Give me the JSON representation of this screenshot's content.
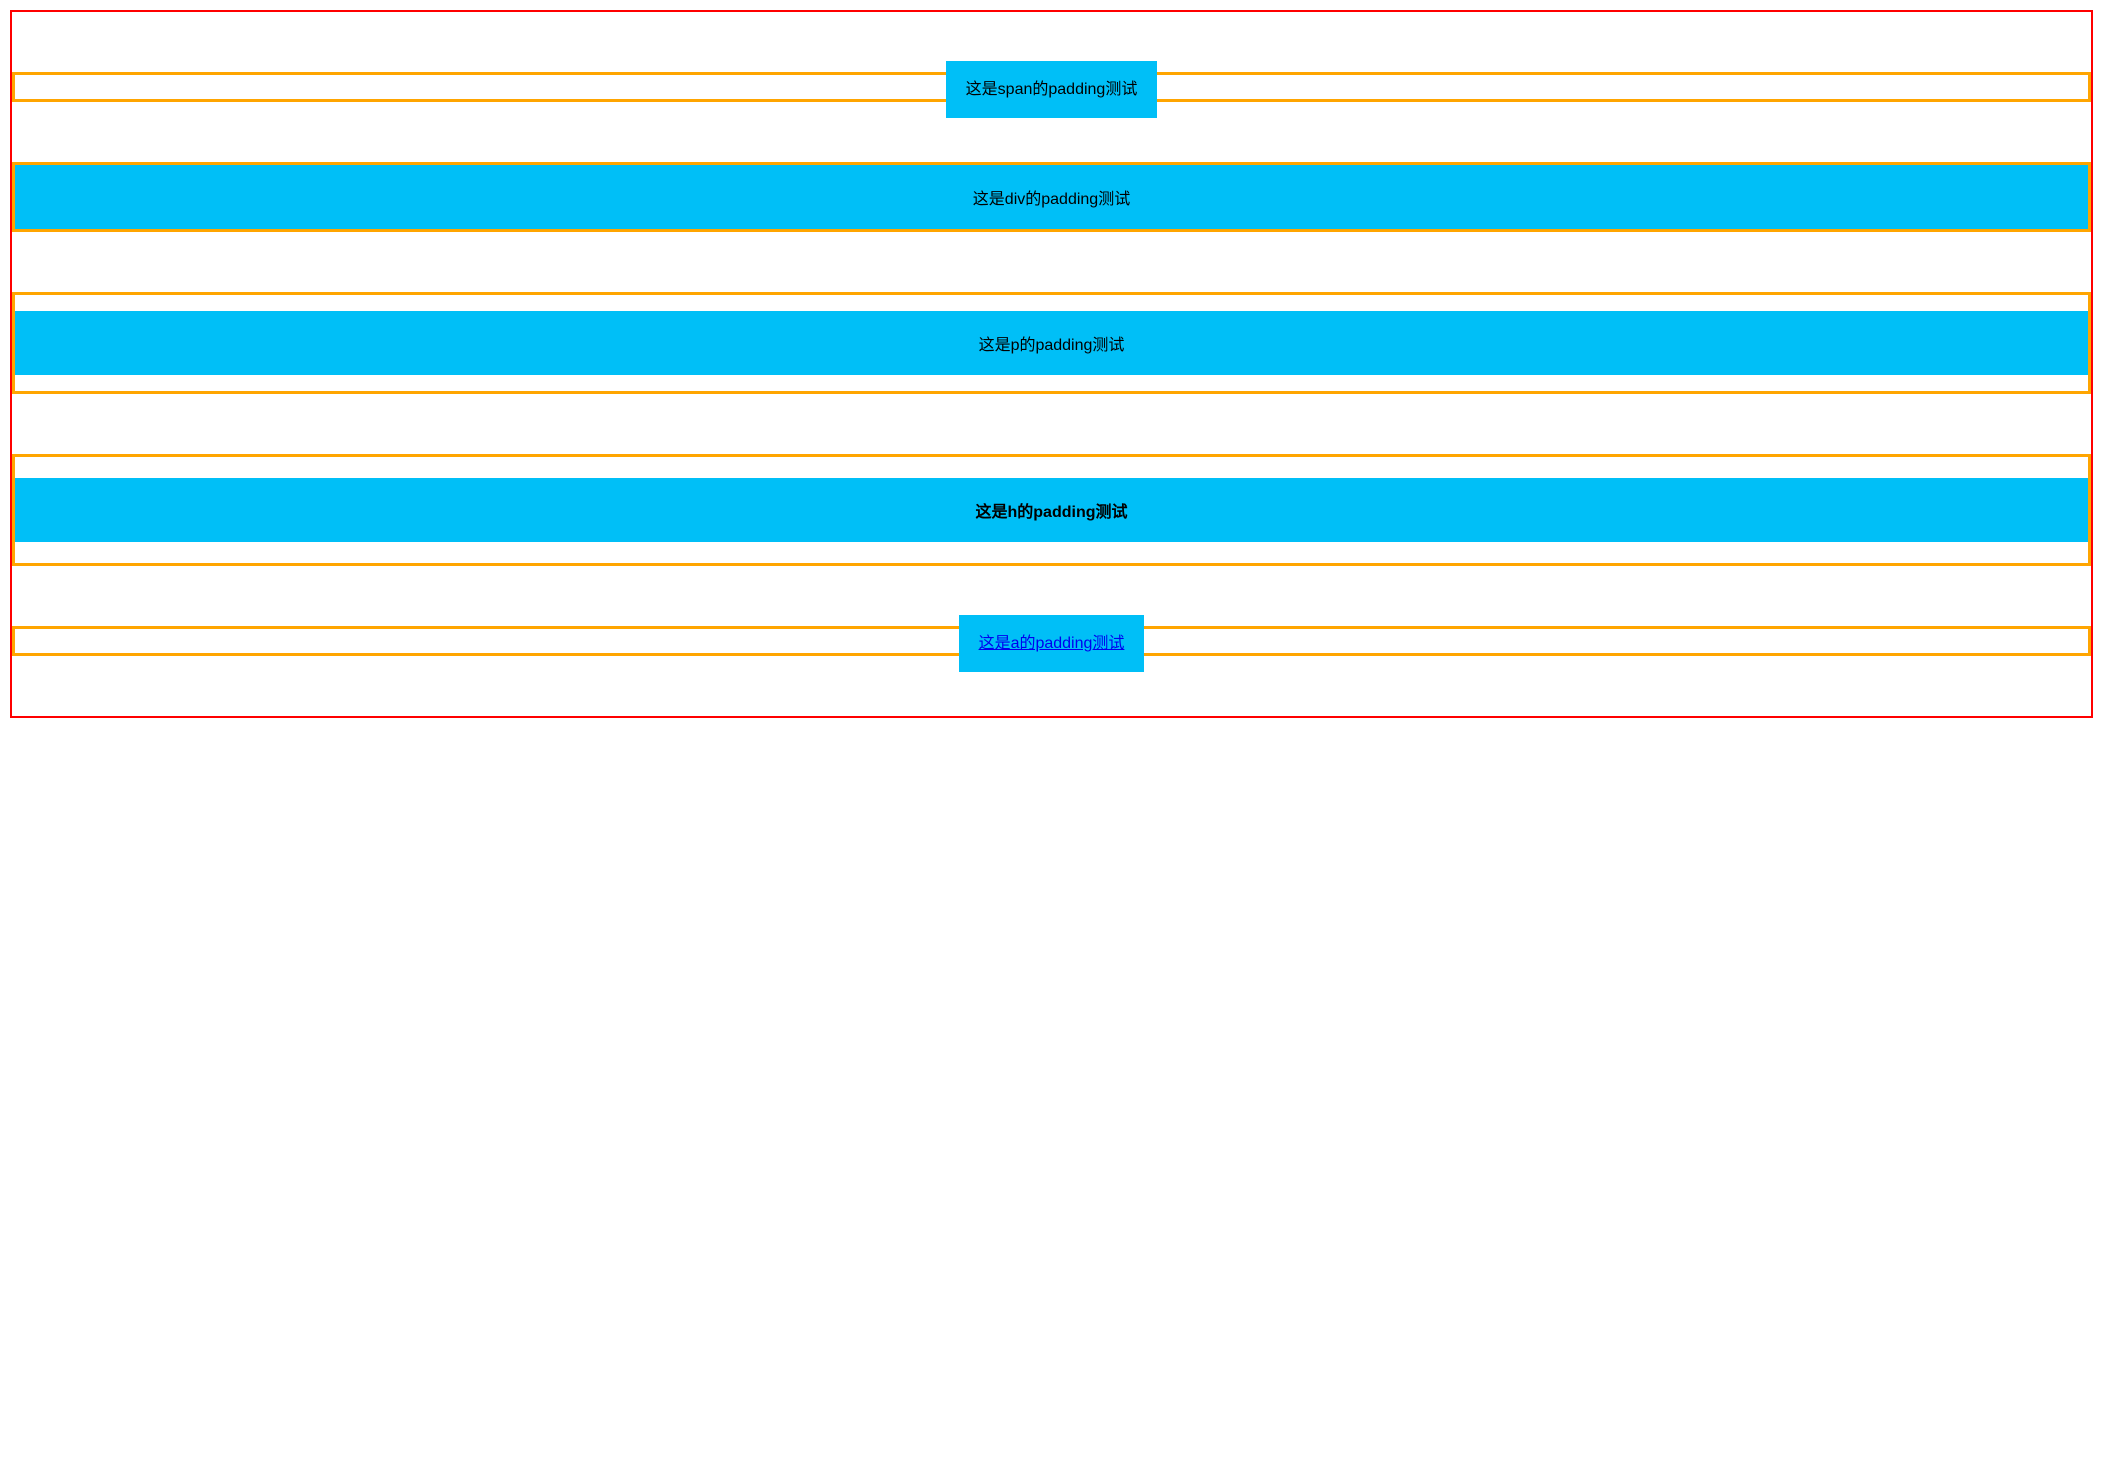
{
  "rows": [
    {
      "tag": "span",
      "label": "这是span的padding测试"
    },
    {
      "tag": "div",
      "label": "这是div的padding测试"
    },
    {
      "tag": "p",
      "label": "这是p的padding测试"
    },
    {
      "tag": "h4",
      "label": "这是h的padding测试"
    },
    {
      "tag": "a",
      "label": "这是a的padding测试"
    }
  ],
  "colors": {
    "outer_border": "#ff0000",
    "wrapper_border": "#ffa500",
    "inner_bg": "#00bff7",
    "link": "#0000ee"
  }
}
